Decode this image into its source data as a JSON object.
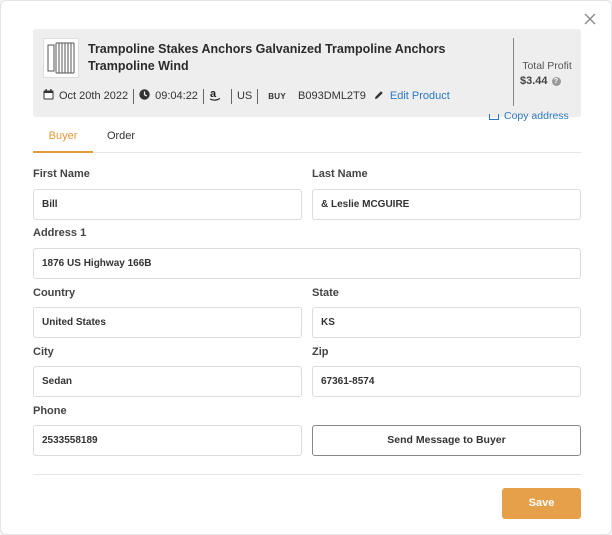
{
  "close_icon": "close-icon",
  "product": {
    "title": "Trampoline Stakes Anchors Galvanized Trampoline Anchors Trampoline Wind",
    "date": "Oct 20th 2022",
    "time": "09:04:22",
    "marketplace_icon": "amazon-icon",
    "country": "US",
    "buy_badge": "BUY",
    "asin": "B093DML2T9",
    "edit_label": "Edit Product"
  },
  "profit": {
    "label": "Total Profit",
    "value": "$3.44"
  },
  "copy_address_label": "Copy address",
  "tabs": [
    {
      "label": "Buyer",
      "active": true
    },
    {
      "label": "Order",
      "active": false
    }
  ],
  "form": {
    "first_name": {
      "label": "First Name",
      "value": "Bill"
    },
    "last_name": {
      "label": "Last Name",
      "value": "& Leslie MCGUIRE"
    },
    "address1": {
      "label": "Address 1",
      "value": "1876 US Highway 166B"
    },
    "country": {
      "label": "Country",
      "value": "United States"
    },
    "state": {
      "label": "State",
      "value": "KS"
    },
    "city": {
      "label": "City",
      "value": "Sedan"
    },
    "zip": {
      "label": "Zip",
      "value": "67361-8574"
    },
    "phone": {
      "label": "Phone",
      "value": "2533558189"
    }
  },
  "send_message_label": "Send Message to Buyer",
  "save_label": "Save",
  "colors": {
    "accent": "#e6a04a",
    "link": "#2c78c4"
  }
}
